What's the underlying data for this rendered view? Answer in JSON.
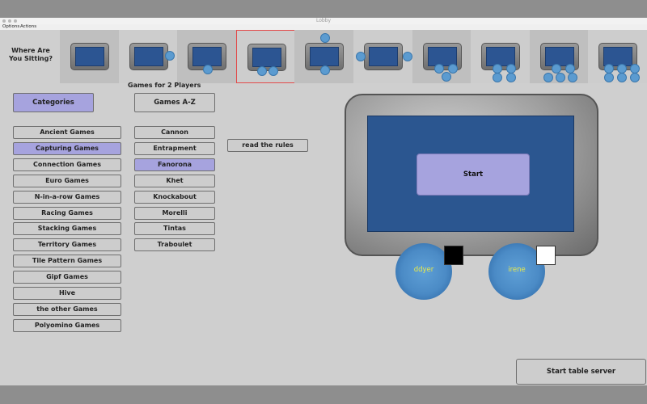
{
  "window": {
    "title": "Lobby"
  },
  "menu": {
    "options": "Options",
    "actions": "Actions"
  },
  "seating": {
    "label_line1": "Where Are",
    "label_line2": "You Sitting?",
    "selected_index": 3,
    "options": [
      {
        "seats": 0
      },
      {
        "seats": 1
      },
      {
        "seats": 1
      },
      {
        "seats": 2
      },
      {
        "seats": 2
      },
      {
        "seats": 2
      },
      {
        "seats": 3
      },
      {
        "seats": 4
      },
      {
        "seats": 5
      },
      {
        "seats": 6
      }
    ]
  },
  "games_header": "Games for 2 Players",
  "categories_button": "Categories",
  "games_az_button": "Games A-Z",
  "categories": [
    "Ancient Games",
    "Capturing Games",
    "Connection Games",
    "Euro Games",
    "N-in-a-row Games",
    "Racing Games",
    "Stacking Games",
    "Territory Games",
    "Tile Pattern Games",
    "Gipf Games",
    "Hive",
    "the other Games",
    "Polyomino Games"
  ],
  "selected_category": "Capturing Games",
  "games": [
    "Cannon",
    "Entrapment",
    "Fanorona",
    "Khet",
    "Knockabout",
    "Morelli",
    "Tintas",
    "Traboulet"
  ],
  "selected_game": "Fanorona",
  "read_rules": "read the rules",
  "start_label": "Start",
  "players": [
    {
      "name": "ddyer",
      "color": "#000000"
    },
    {
      "name": "irene",
      "color": "#ffffff"
    }
  ],
  "start_server": "Start table server",
  "colors": {
    "accent": "#a6a3de",
    "felt": "#2b5690",
    "seat": "#5b9bd0"
  }
}
